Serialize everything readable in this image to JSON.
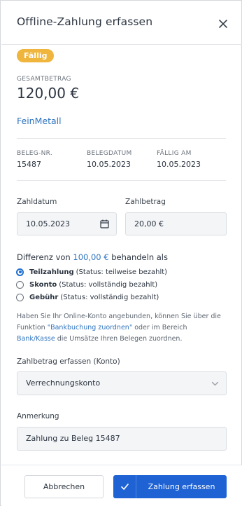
{
  "header": {
    "title": "Offline-Zahlung erfassen",
    "close_icon": "close-icon"
  },
  "status_badge": "Fällig",
  "summary": {
    "total_label": "GESAMTBETRAG",
    "total_value": "120,00 €",
    "company": "FeinMetall"
  },
  "details": {
    "beleg_label": "BELEG-NR.",
    "beleg_value": "15487",
    "belegdatum_label": "BELEGDATUM",
    "belegdatum_value": "10.05.2023",
    "faellig_label": "FÄLLIG AM",
    "faellig_value": "10.05.2023"
  },
  "form": {
    "zahldatum_label": "Zahldatum",
    "zahldatum_value": "10.05.2023",
    "zahlbetrag_label": "Zahlbetrag",
    "zahlbetrag_value": "20,00 €"
  },
  "difference": {
    "prefix": "Differenz von ",
    "amount": "100,00 €",
    "suffix": " behandeln als",
    "options": [
      {
        "label": "Teilzahlung",
        "status": "(Status: teilweise bezahlt)",
        "selected": true
      },
      {
        "label": "Skonto",
        "status": "(Status: vollständig bezahlt)",
        "selected": false
      },
      {
        "label": "Gebühr",
        "status": "(Status: vollständig bezahlt)",
        "selected": false
      }
    ]
  },
  "info": {
    "part1": "Haben Sie Ihr Online-Konto angebunden, können Sie über die Funktion ",
    "link1": "\"Bankbuchung zuordnen\"",
    "part2": " oder im Bereich ",
    "link2": "Bank/Kasse",
    "part3": " die Umsätze Ihren Belegen zuordnen."
  },
  "konto": {
    "label": "Zahlbetrag erfassen (Konto)",
    "value": "Verrechnungskonto"
  },
  "anmerkung": {
    "label": "Anmerkung",
    "value": "Zahlung zu Beleg 15487"
  },
  "footer": {
    "cancel_label": "Abbrechen",
    "submit_label": "Zahlung erfassen"
  },
  "colors": {
    "accent": "#1e62d4",
    "link": "#2f74c0",
    "badge": "#efb53c"
  }
}
